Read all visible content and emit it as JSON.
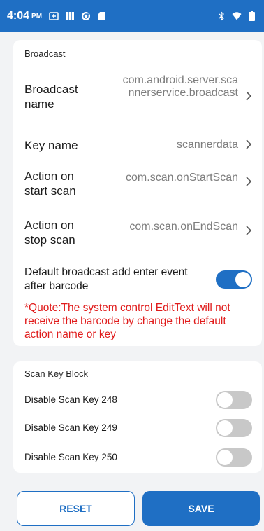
{
  "status_bar": {
    "time": "4:04",
    "ampm": "PM",
    "left_icons": [
      "sim-icon",
      "calendar-icon",
      "sync-icon",
      "sd-card-icon"
    ],
    "right_icons": [
      "bluetooth-icon",
      "wifi-icon",
      "battery-icon"
    ]
  },
  "broadcast": {
    "section_title": "Broadcast",
    "broadcast_name": {
      "title": "Broadcast name",
      "value": "com.android.server.scannerservice.broadcast"
    },
    "key_name": {
      "title": "Key name",
      "value": "scannerdata"
    },
    "action_start": {
      "title": "Action on start scan",
      "value": "com.scan.onStartScan"
    },
    "action_stop": {
      "title": "Action on stop scan",
      "value": "com.scan.onEndScan"
    },
    "enter_event": {
      "title": "Default broadcast add enter event after barcode",
      "enabled": true
    },
    "quote": "*Quote:The system control EditText will not receive the barcode by change the default action name or key"
  },
  "scan_key_block": {
    "section_title": "Scan Key Block",
    "items": [
      {
        "label": "Disable Scan Key 248",
        "enabled": false
      },
      {
        "label": "Disable Scan Key 249",
        "enabled": false
      },
      {
        "label": "Disable Scan Key 250",
        "enabled": false
      }
    ]
  },
  "buttons": {
    "reset": "RESET",
    "save": "SAVE"
  },
  "colors": {
    "accent": "#1f6fc4",
    "warning_text": "#e01b1b",
    "background": "#f2f3f5"
  }
}
